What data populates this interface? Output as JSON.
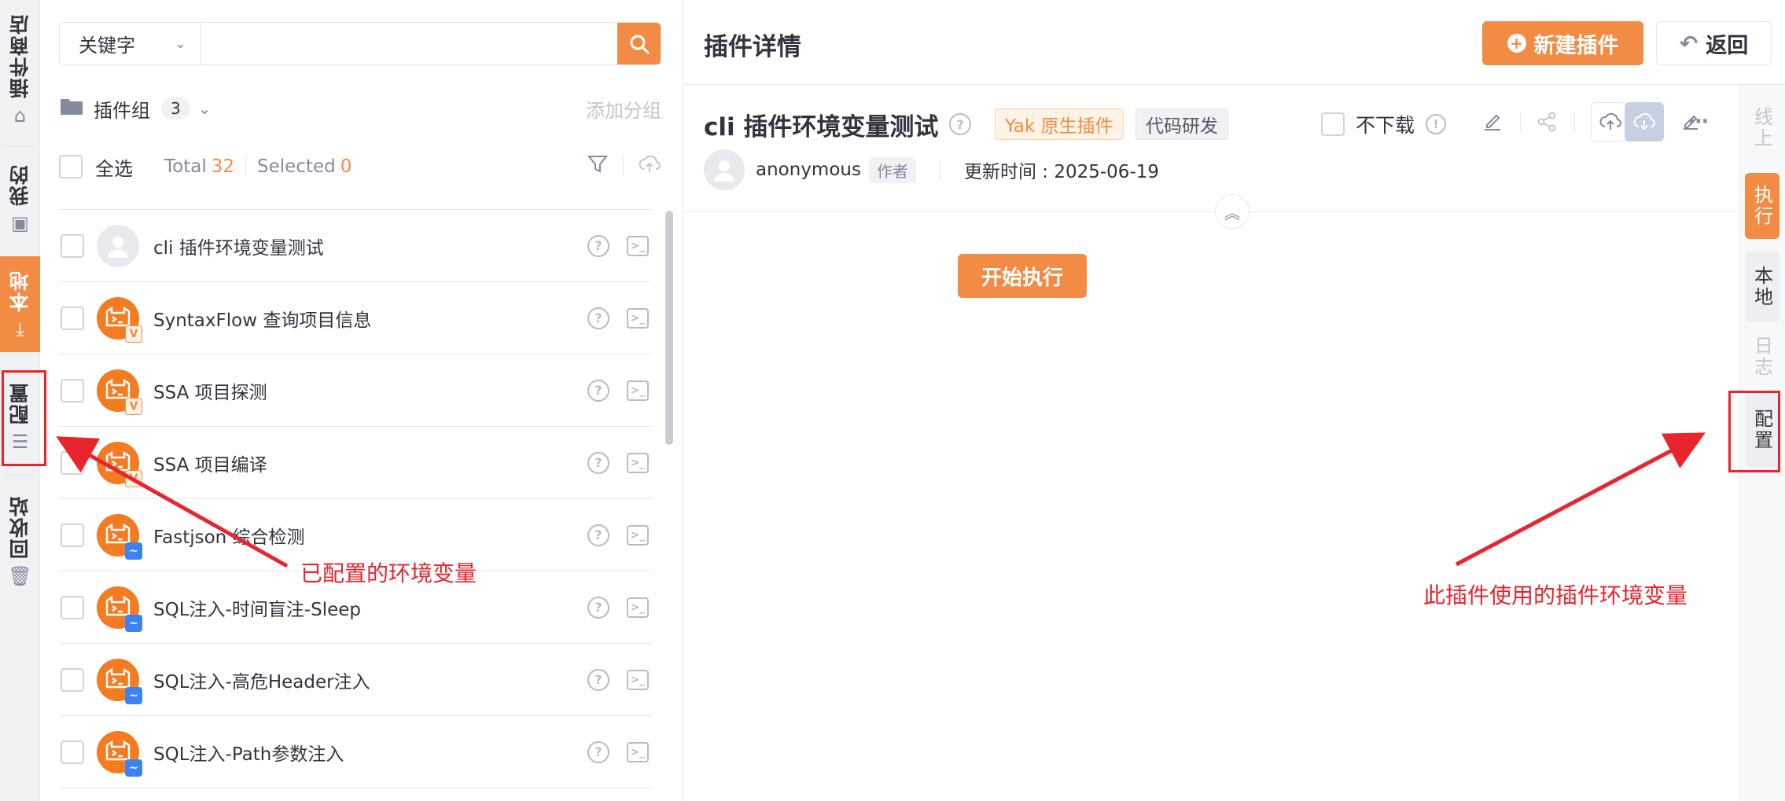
{
  "left_nav": {
    "items": [
      {
        "label": "插件商店",
        "icon": "store-icon"
      },
      {
        "label": "我的",
        "icon": "user-card-icon"
      },
      {
        "label": "本地",
        "icon": "download-icon",
        "active": true
      },
      {
        "label": "配置",
        "icon": "sliders-icon"
      },
      {
        "label": "回收站",
        "icon": "trash-icon"
      }
    ]
  },
  "search": {
    "type_select": "关键字",
    "value": "",
    "placeholder": ""
  },
  "group": {
    "title": "插件组",
    "count": "3",
    "add_label": "添加分组"
  },
  "selection": {
    "select_all_label": "全选",
    "total_label": "Total",
    "total_value": "32",
    "selected_label": "Selected",
    "selected_value": "0"
  },
  "plugins": [
    {
      "name": "cli 插件环境变量测试",
      "avatar": "gray",
      "badge": ""
    },
    {
      "name": "SyntaxFlow 查询项目信息",
      "avatar": "orange",
      "badge": "v"
    },
    {
      "name": "SSA 项目探测",
      "avatar": "orange",
      "badge": "v"
    },
    {
      "name": "SSA 项目编译",
      "avatar": "orange",
      "badge": "v"
    },
    {
      "name": "Fastjson 综合检测",
      "avatar": "orange",
      "badge": "w"
    },
    {
      "name": "SQL注入-时间盲注-Sleep",
      "avatar": "orange",
      "badge": "w"
    },
    {
      "name": "SQL注入-高危Header注入",
      "avatar": "orange",
      "badge": "w"
    },
    {
      "name": "SQL注入-Path参数注入",
      "avatar": "orange",
      "badge": "w"
    }
  ],
  "detail": {
    "header_title": "插件详情",
    "new_button": "新建插件",
    "back_button": "返回",
    "plugin_title": "cli 插件环境变量测试",
    "tag_type": "Yak 原生插件",
    "tag_category": "代码研发",
    "no_download_label": "不下载",
    "author": "anonymous",
    "author_role": "作者",
    "updated": "更新时间 : 2025-06-19",
    "run_button": "开始执行"
  },
  "right_tabs": [
    {
      "label": "线上",
      "state": "dim"
    },
    {
      "label": "执行",
      "state": "active"
    },
    {
      "label": "本地",
      "state": "normal"
    },
    {
      "label": "日志",
      "state": "dim"
    },
    {
      "label": "配置",
      "state": "normal"
    }
  ],
  "annotations": {
    "left_text": "已配置的环境变量",
    "right_text": "此插件使用的插件环境变量",
    "color": "#e8242c"
  },
  "colors": {
    "accent": "#f28b44",
    "annotation": "#e8242c"
  }
}
